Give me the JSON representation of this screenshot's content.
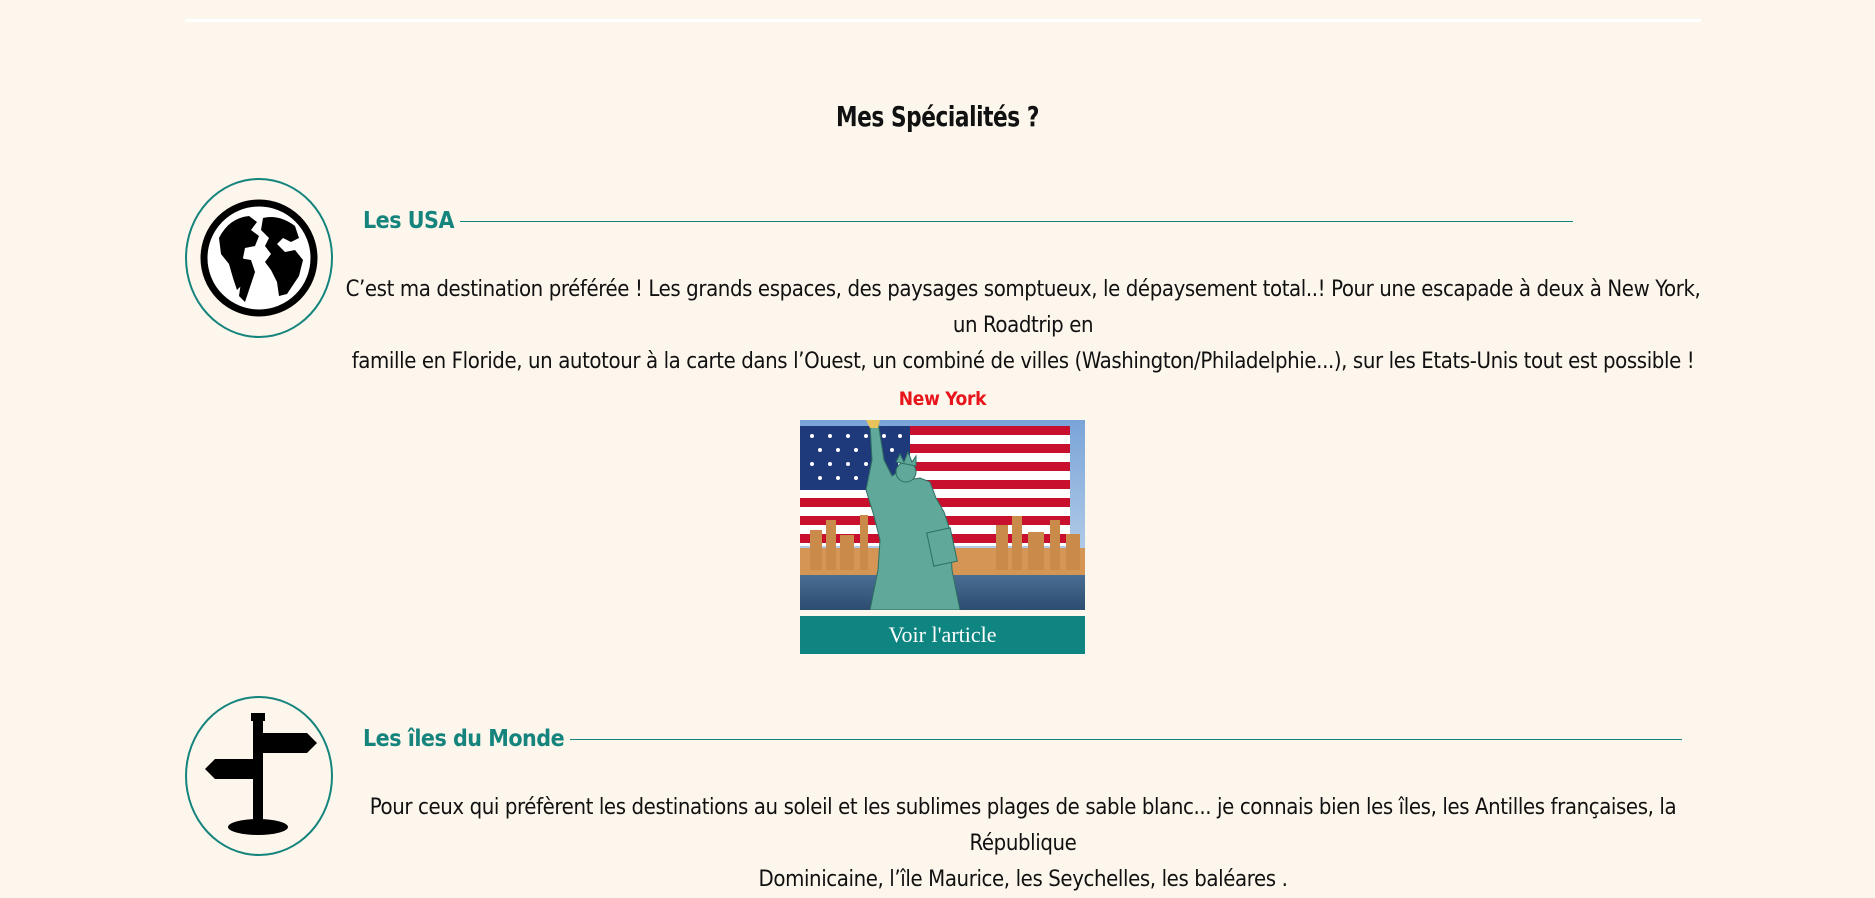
{
  "section": {
    "title": "Mes Spécialités ?"
  },
  "specialties": [
    {
      "title": "Les USA",
      "icon": "globe-icon",
      "text_line1": "C’est ma destination préférée ! Les grands espaces, des paysages somptueux, le dépaysement total..! Pour une escapade à deux à New York, un Roadtrip en",
      "text_line2": "famille en Floride, un autotour à la carte dans l’Ouest, un combiné de villes (Washington/Philadelphie...), sur les Etats-Unis tout est possible !"
    },
    {
      "title": "Les îles du Monde",
      "icon": "signpost-icon",
      "text_line1": "Pour ceux qui préfèrent les destinations au soleil et les sublimes plages de sable blanc... je connais bien les îles, les Antilles françaises, la République",
      "text_line2": "Dominicaine, l’île Maurice, les Seychelles, les baléares ."
    }
  ],
  "article_card": {
    "title": "New York",
    "image": "statue-of-liberty-flag-photo",
    "button_label": "Voir l'article"
  },
  "colors": {
    "background": "#fdf6ec",
    "accent": "#14847d",
    "button": "#0e8580",
    "card_title": "#e8141b"
  }
}
